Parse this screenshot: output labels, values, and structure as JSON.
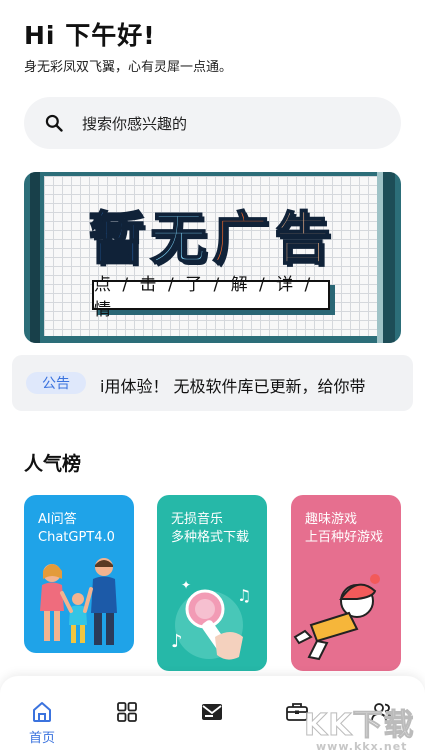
{
  "header": {
    "greeting": "Hi 下午好!",
    "motto": "身无彩凤双飞翼，心有灵犀一点通。"
  },
  "search": {
    "placeholder": "搜索你感兴趣的",
    "icon": "search-icon"
  },
  "banner": {
    "title_chars": [
      "暂",
      "无",
      "广",
      "告"
    ],
    "button_label": "点 / 击 / 了 / 解 / 详 / 情"
  },
  "notice": {
    "tag": "公告",
    "text": "i用体验！   无极软件库已更新，给你带"
  },
  "section": {
    "title": "人气榜"
  },
  "cards": [
    {
      "title": "AI问答\nChatGPT4.0",
      "color": "#1fa3e8"
    },
    {
      "title": "无损音乐\n多种格式下载",
      "color": "#26b8a8"
    },
    {
      "title": "趣味游戏\n上百种好游戏",
      "color": "#e66f8f"
    }
  ],
  "tabbar": {
    "items": [
      {
        "icon": "home-icon",
        "label": "首页",
        "active": true
      },
      {
        "icon": "grid-icon",
        "label": ""
      },
      {
        "icon": "mail-icon",
        "label": ""
      },
      {
        "icon": "toolbox-icon",
        "label": ""
      },
      {
        "icon": "users-icon",
        "label": ""
      }
    ],
    "accent": "#3b73de"
  },
  "watermark": {
    "logo": "KK下载",
    "url": "www.kkx.net"
  }
}
